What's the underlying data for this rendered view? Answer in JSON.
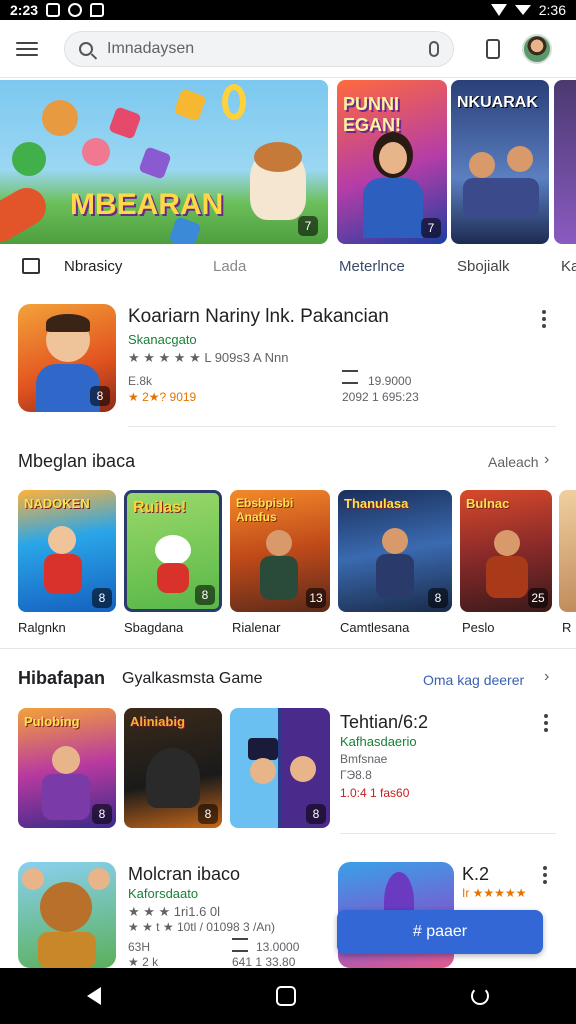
{
  "status": {
    "time": "2:23",
    "clock_right": "2:36"
  },
  "search": {
    "placeholder": "Imnadaysen"
  },
  "banners": [
    {
      "title": "MBEARAN",
      "badge": "7"
    },
    {
      "title": "PUNNI EGAN!",
      "badge": "7"
    },
    {
      "title": "NKUARAK",
      "badge": ""
    }
  ],
  "tabs": [
    "Nbrasicy",
    "Lada",
    "Meterlnce",
    "Sbojialk",
    "Ka"
  ],
  "featured": {
    "title": "Koariarn Nariny lnk. Pakancian",
    "developer": "Skanacgato",
    "rating_line": "★ ★ ★ ★ ★ L 909s3 A Nnn",
    "size": "E.8k",
    "stars": "★ 2★? 9019",
    "stat_1": "19.9000",
    "stat_2": "2092 1 695:23"
  },
  "section1": {
    "title": "Mbeglan ibaca",
    "link": "Aaleach",
    "cards": [
      {
        "title": "NADOKEN",
        "label": "Ralgnkn",
        "badge": "8"
      },
      {
        "title": "Ruilas!",
        "label": "Sbagdana",
        "badge": "8"
      },
      {
        "title": "Ebsbpisbi Anafus",
        "label": "Rialenar",
        "badge": "13"
      },
      {
        "title": "Thanulasa",
        "label": "Camtlesana",
        "badge": "8"
      },
      {
        "title": "Bulnac",
        "label": "Peslo",
        "badge": "25"
      },
      {
        "title": "",
        "label": "R",
        "badge": ""
      }
    ]
  },
  "section2": {
    "title": "Hibafapan",
    "subtitle": "Gyalkasmsta Game",
    "link": "Oma kag deerer",
    "cards": [
      {
        "title": "Pulobing",
        "badge": "8"
      },
      {
        "title": "Aliniabig",
        "badge": "8"
      },
      {
        "title": "",
        "badge": "8"
      }
    ],
    "app": {
      "title": "Tehtian/6:2",
      "developer": "Kafhasdaerio",
      "tag": "Bmfsnae",
      "size": "ГЭ8.8",
      "price": "1.0:4 1 fas60"
    }
  },
  "bottom_app": {
    "title": "Molcran ibaco",
    "developer": "Kaforsdaato",
    "rating": "★ ★ ★ 1ri1.6 0l",
    "rating2": "★ ★ t ★ 10tl / 01098 3 /An)",
    "size": "63H",
    "stars": "★ 2 k",
    "stat_1": "13.0000",
    "stat_2": "641 1 33.80",
    "side_title": "K.2",
    "side_stars": "Ir ★★★★★"
  },
  "fab": {
    "label": "# paaer"
  }
}
